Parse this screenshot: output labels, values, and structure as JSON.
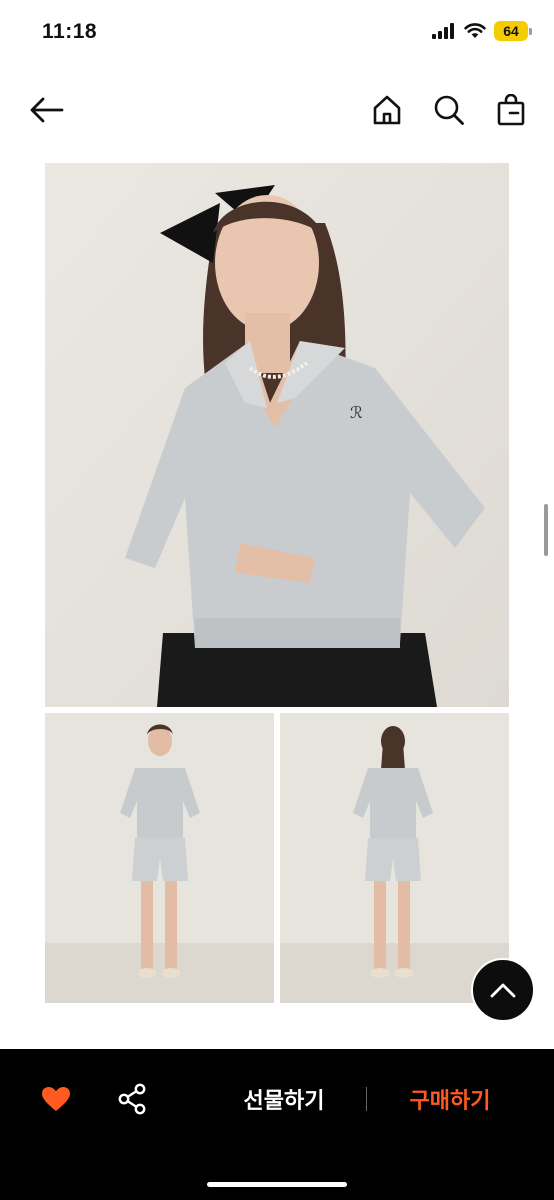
{
  "status_bar": {
    "time": "11:18",
    "battery_level": "64",
    "icons": [
      "signal-icon",
      "wifi-icon",
      "battery-icon"
    ]
  },
  "nav": {
    "icons": [
      "back-arrow-icon",
      "home-icon",
      "search-icon",
      "shopping-bag-icon"
    ]
  },
  "images": [
    {
      "name": "product-photo-main",
      "subject": "model-upper-body"
    },
    {
      "name": "product-photo-front",
      "subject": "model-full-front"
    },
    {
      "name": "product-photo-back",
      "subject": "model-full-back"
    }
  ],
  "bottom_bar": {
    "gift_label": "선물하기",
    "buy_label": "구매하기",
    "icons": [
      "heart-icon",
      "share-icon"
    ]
  },
  "colors": {
    "accent": "#ff5a1f",
    "like": "#ff5a1f",
    "bar_background": "#000000",
    "battery": "#f5cc00"
  }
}
